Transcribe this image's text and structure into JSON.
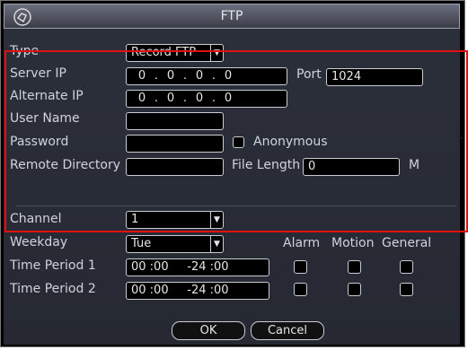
{
  "window": {
    "title": "FTP"
  },
  "colors": {
    "accent_red": "#e01010",
    "panel_bg": "#2b2f3a",
    "text": "#cfd3db"
  },
  "labels": {
    "type": "Type",
    "server_ip": "Server IP",
    "port": "Port",
    "alternate_ip": "Alternate IP",
    "user_name": "User Name",
    "password": "Password",
    "anonymous": "Anonymous",
    "remote_directory": "Remote Directory",
    "file_length": "File Length",
    "file_length_unit": "M",
    "channel": "Channel",
    "weekday": "Weekday",
    "alarm": "Alarm",
    "motion": "Motion",
    "general": "General",
    "time_period_1": "Time Period 1",
    "time_period_2": "Time Period 2"
  },
  "values": {
    "type": "Record FTP",
    "server_ip": [
      "0",
      "0",
      "0",
      "0"
    ],
    "port": "1024",
    "alternate_ip": [
      "0",
      "0",
      "0",
      "0"
    ],
    "user_name": "",
    "password": "",
    "remote_directory": "",
    "file_length": "0",
    "channel": "1",
    "weekday": "Tue",
    "time_period_1": "00 :00     -24 :00",
    "time_period_2": "00 :00     -24 :00"
  },
  "dropdown_arrow": "▼",
  "buttons": {
    "ok": "OK",
    "cancel": "Cancel"
  }
}
